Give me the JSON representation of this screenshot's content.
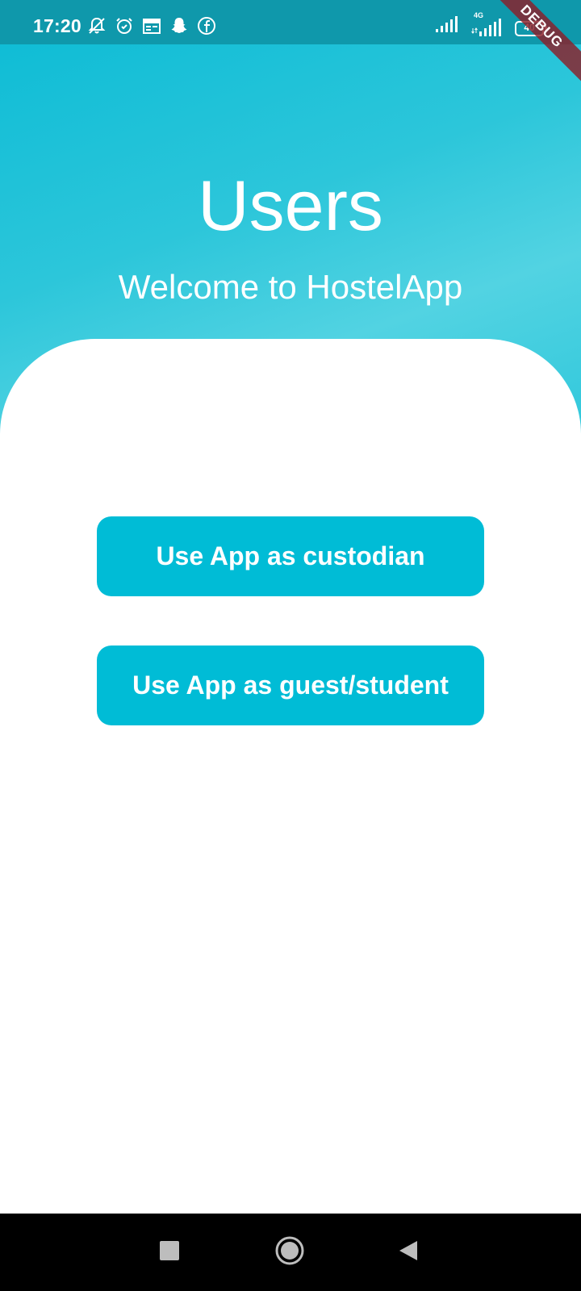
{
  "status_bar": {
    "time": "17:20",
    "network_label": "4G",
    "battery_level": "40",
    "left_icons": [
      "notifications-off-icon",
      "alarm-icon",
      "calendar-icon",
      "snapchat-icon",
      "facebook-icon"
    ],
    "right_icons": [
      "signal-icon",
      "signal-4g-icon",
      "battery-icon"
    ]
  },
  "debug_banner": {
    "label": "DEBUG"
  },
  "header": {
    "title": "Users",
    "subtitle": "Welcome to HostelApp"
  },
  "actions": {
    "custodian_label": "Use App as custodian",
    "guest_label": "Use App as guest/student"
  },
  "navigation": {
    "buttons": [
      "recent-apps",
      "home",
      "back"
    ]
  },
  "colors": {
    "accent": "#00bcd6",
    "status_bar": "#0f98ab",
    "gradient_start": "#0bbbd5",
    "gradient_light": "#52d3e2",
    "background": "#ffffff",
    "nav_bar": "#000000"
  }
}
